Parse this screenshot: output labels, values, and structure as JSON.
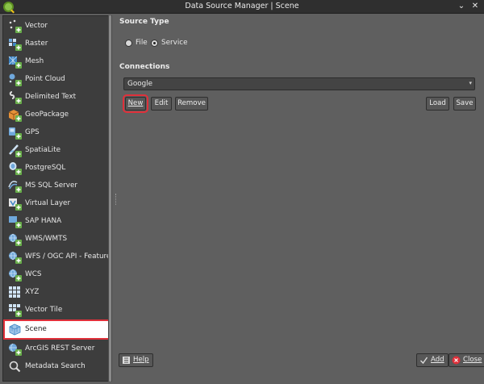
{
  "window": {
    "title": "Data Source Manager | Scene",
    "collapse_glyph": "⌄",
    "close_glyph": "✕"
  },
  "sidebar": {
    "items": [
      {
        "label": "Vector",
        "icon": "vector-icon"
      },
      {
        "label": "Raster",
        "icon": "raster-icon"
      },
      {
        "label": "Mesh",
        "icon": "mesh-icon"
      },
      {
        "label": "Point Cloud",
        "icon": "point-cloud-icon"
      },
      {
        "label": "Delimited Text",
        "icon": "delimited-text-icon"
      },
      {
        "label": "GeoPackage",
        "icon": "geopackage-icon"
      },
      {
        "label": "GPS",
        "icon": "gps-icon"
      },
      {
        "label": "SpatiaLite",
        "icon": "spatialite-icon"
      },
      {
        "label": "PostgreSQL",
        "icon": "postgresql-icon"
      },
      {
        "label": "MS SQL Server",
        "icon": "mssql-icon"
      },
      {
        "label": "Virtual Layer",
        "icon": "virtual-layer-icon"
      },
      {
        "label": "SAP HANA",
        "icon": "sap-hana-icon"
      },
      {
        "label": "WMS/WMTS",
        "icon": "wms-icon"
      },
      {
        "label": "WFS / OGC API - Features",
        "icon": "wfs-icon"
      },
      {
        "label": "WCS",
        "icon": "wcs-icon"
      },
      {
        "label": "XYZ",
        "icon": "xyz-icon"
      },
      {
        "label": "Vector Tile",
        "icon": "vector-tile-icon"
      },
      {
        "label": "Scene",
        "icon": "scene-icon",
        "selected": true
      },
      {
        "label": "ArcGIS REST Server",
        "icon": "arcgis-icon"
      },
      {
        "label": "Metadata Search",
        "icon": "metadata-search-icon"
      }
    ]
  },
  "source_type": {
    "title": "Source Type",
    "options": [
      {
        "label": "File",
        "selected": false
      },
      {
        "label": "Service",
        "selected": true
      }
    ]
  },
  "connections": {
    "title": "Connections",
    "selected": "Google",
    "buttons": {
      "new": "New",
      "edit": "Edit",
      "remove": "Remove",
      "load": "Load",
      "save": "Save"
    }
  },
  "footer": {
    "help": "Help",
    "add": "Add",
    "close": "Close"
  },
  "colors": {
    "accent_red": "#e0303a",
    "qgis_green": "#8bc34a"
  }
}
